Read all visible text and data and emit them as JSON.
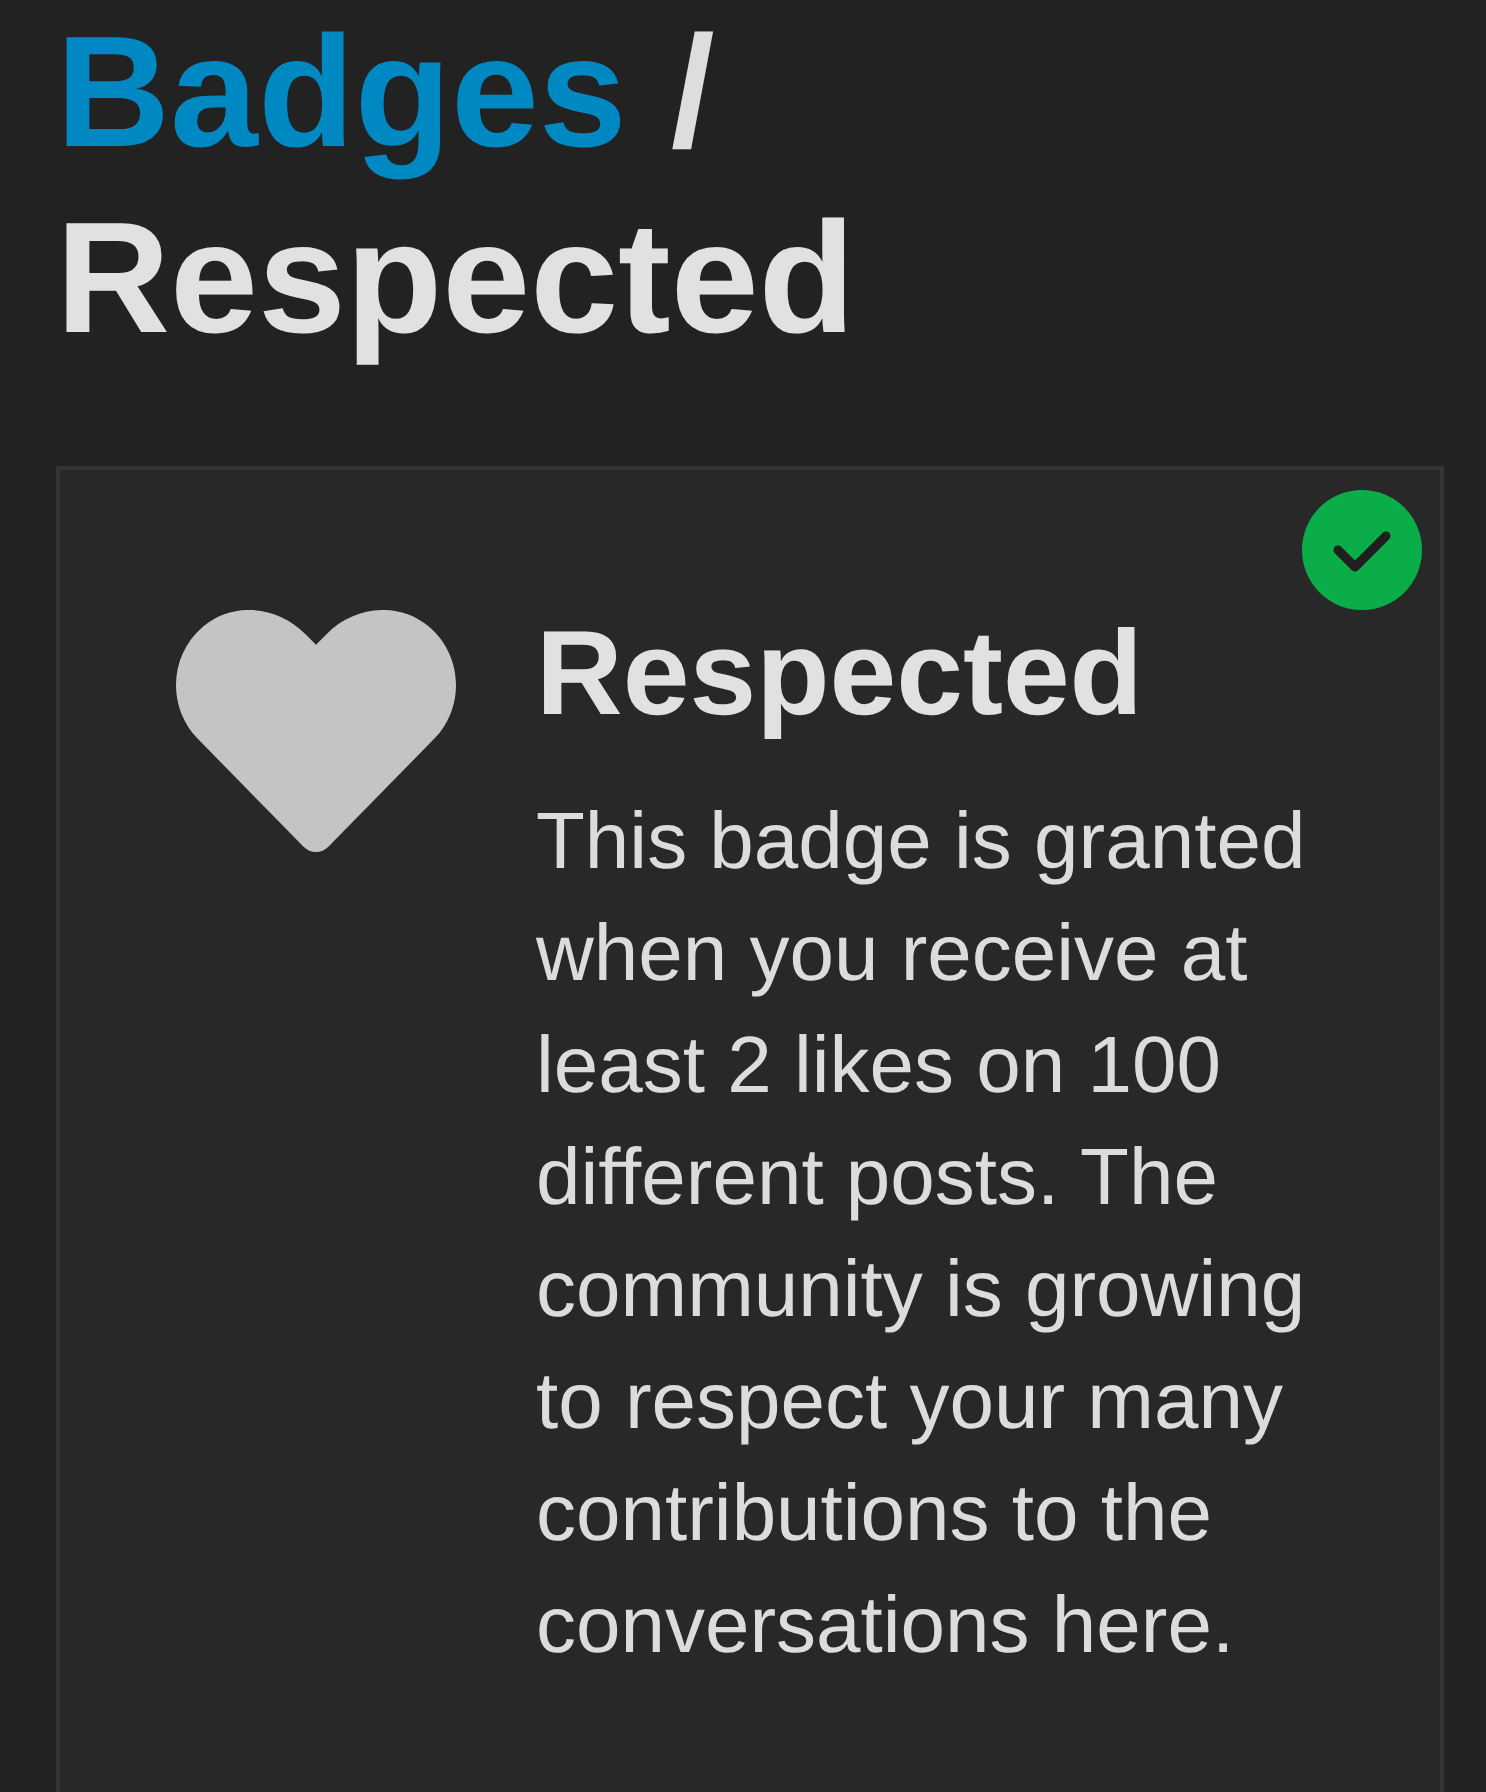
{
  "breadcrumb": {
    "parent": "Badges",
    "separator": "/",
    "current": "Respected"
  },
  "badge": {
    "title": "Respected",
    "description": "This badge is granted when you receive at least 2 likes on 100 different posts. The community is growing to respect your many contributions to the conversations here.",
    "granted": true
  }
}
